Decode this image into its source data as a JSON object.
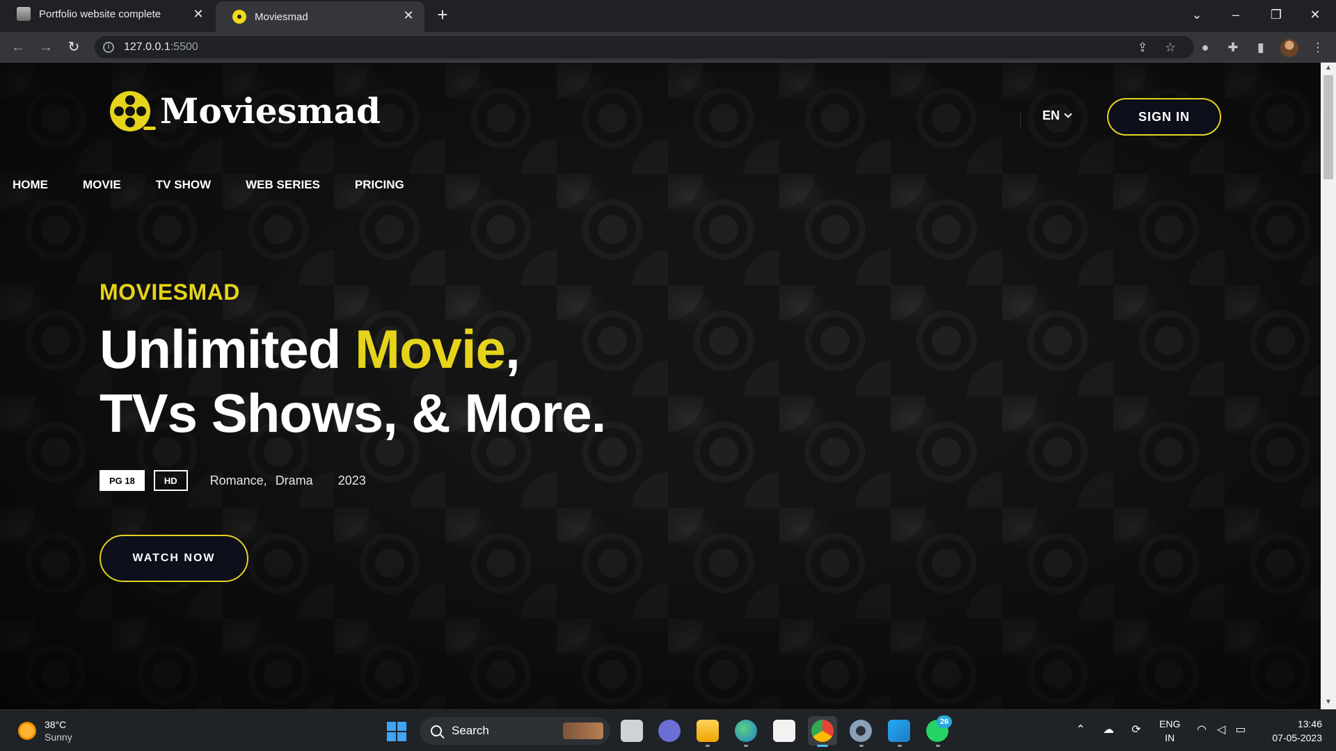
{
  "browser": {
    "tabs": [
      {
        "title": "Portfolio website complete",
        "active": false
      },
      {
        "title": "Moviesmad",
        "active": true
      }
    ],
    "url_host": "127.0.0.1",
    "url_port": ":5500"
  },
  "page": {
    "brand": "Moviesmad",
    "language": "EN",
    "signin_label": "SIGN IN",
    "nav": [
      "HOME",
      "MOVIE",
      "TV SHOW",
      "WEB SERIES",
      "PRICING"
    ],
    "hero": {
      "subtitle": "MOVIESMAD",
      "title_part1": "Unlimited ",
      "title_highlight": "Movie",
      "title_part2": ",",
      "title_line2": "TVs Shows, & More.",
      "rating_badge": "PG 18",
      "quality_badge": "HD",
      "genres": [
        "Romance,",
        "Drama"
      ],
      "year": "2023",
      "cta_label": "WATCH NOW"
    },
    "colors": {
      "accent": "#e5d41b",
      "background": "#141414",
      "button_bg": "#0d0f1a"
    }
  },
  "taskbar": {
    "weather_temp": "38°C",
    "weather_condition": "Sunny",
    "search_label": "Search",
    "whatsapp_badge": "26",
    "lang_primary": "ENG",
    "lang_region": "IN",
    "time": "13:46",
    "date": "07-05-2023"
  }
}
